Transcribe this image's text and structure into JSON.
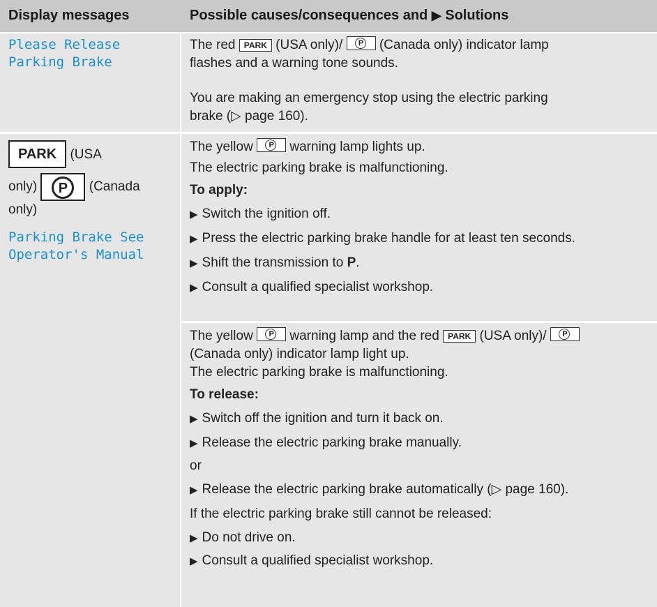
{
  "header": {
    "col1": "Display messages",
    "col2": "Possible causes/consequences and",
    "col2_suffix": "Solutions"
  },
  "rows": [
    {
      "message": [
        "Please Release",
        "Parking Brake"
      ],
      "cause_line1_a": "The red",
      "cause_line1_b": "(USA only)/",
      "cause_line1_c": "(Canada only) indicator lamp",
      "cause_line2": "flashes and a warning tone sounds.",
      "info_line1": "You are making an emergency stop using the electric parking",
      "info_line2": "brake (▷ page 160)."
    },
    {
      "symbol_park": "PARK",
      "symbol_usa": "(USA",
      "symbol_only1": "only)",
      "symbol_canada": "(Canada",
      "symbol_only2": "only)",
      "message": [
        "Parking Brake See",
        "Operator's Manual"
      ],
      "case1": {
        "line1_a": "The yellow",
        "line1_b": "warning lamp lights up.",
        "line2": "The electric parking brake is malfunctioning.",
        "heading": "To apply:",
        "steps": [
          "Switch the ignition off.",
          "Press the electric parking brake handle for at least ten seconds.",
          "Shift the transmission to",
          "Consult a qualified specialist workshop."
        ],
        "step3_bold": "P",
        "step3_end": "."
      },
      "case2": {
        "line1_a": "The yellow",
        "line1_b": "warning lamp and the red",
        "line1_c": "(USA only)/",
        "line2": "(Canada only) indicator lamp light up.",
        "line3": "The electric parking brake is malfunctioning.",
        "heading": "To release:",
        "step1": "Switch off the ignition and turn it back on.",
        "step2": "Release the electric parking brake manually.",
        "or": "or",
        "step3": "Release the electric parking brake automatically (▷ page 160).",
        "note": "If the electric parking brake still cannot be released:",
        "step4": "Do not drive on.",
        "step5": "Consult a qualified specialist workshop."
      }
    }
  ],
  "lamp_labels": {
    "park": "PARK",
    "p": "P"
  }
}
